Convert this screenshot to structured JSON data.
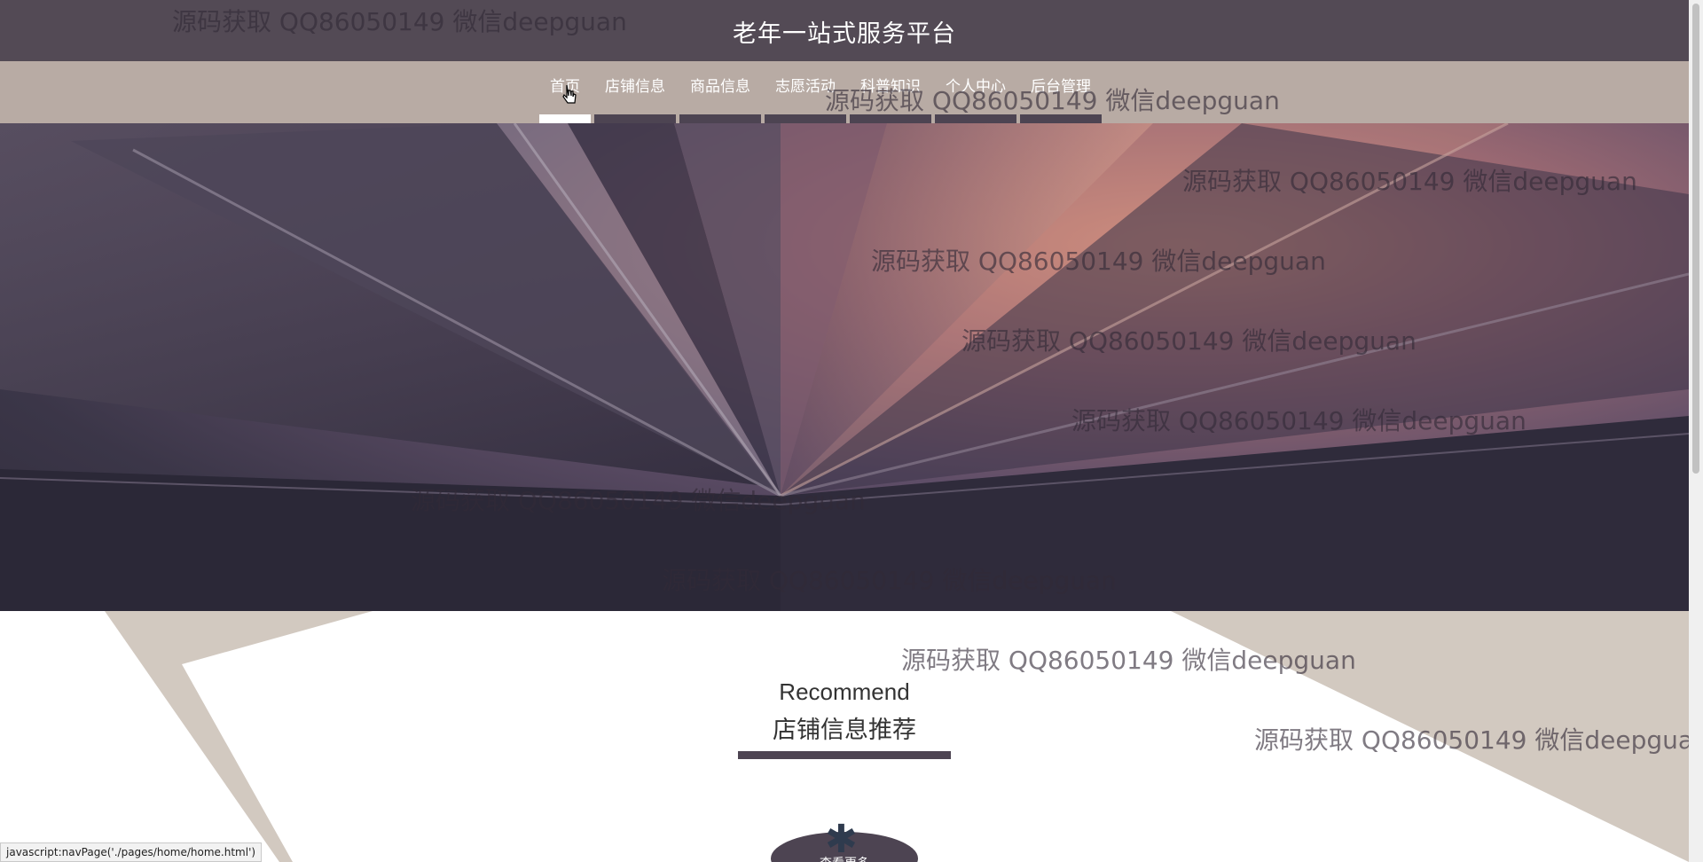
{
  "header": {
    "title": "老年一站式服务平台"
  },
  "nav": {
    "items": [
      {
        "label": "首页",
        "active": true
      },
      {
        "label": "店铺信息"
      },
      {
        "label": "商品信息"
      },
      {
        "label": "志愿活动"
      },
      {
        "label": "科普知识"
      },
      {
        "label": "个人中心"
      },
      {
        "label": "后台管理"
      }
    ]
  },
  "banner": {
    "slide_count": 3,
    "active_slide": 1
  },
  "recommend": {
    "title_en": "Recommend",
    "title_cn": "店铺信息推荐",
    "more_label": "查看更多"
  },
  "watermark": {
    "text": "源码获取 QQ86050149 微信deepguan"
  },
  "status_bar": {
    "text": "javascript:navPage('./pages/home/home.html')"
  },
  "colors": {
    "header_bg": "#534a55",
    "nav_bg": "#b8aba4",
    "accent": "#4d4452",
    "lower_shape": "#d2c9c0"
  }
}
